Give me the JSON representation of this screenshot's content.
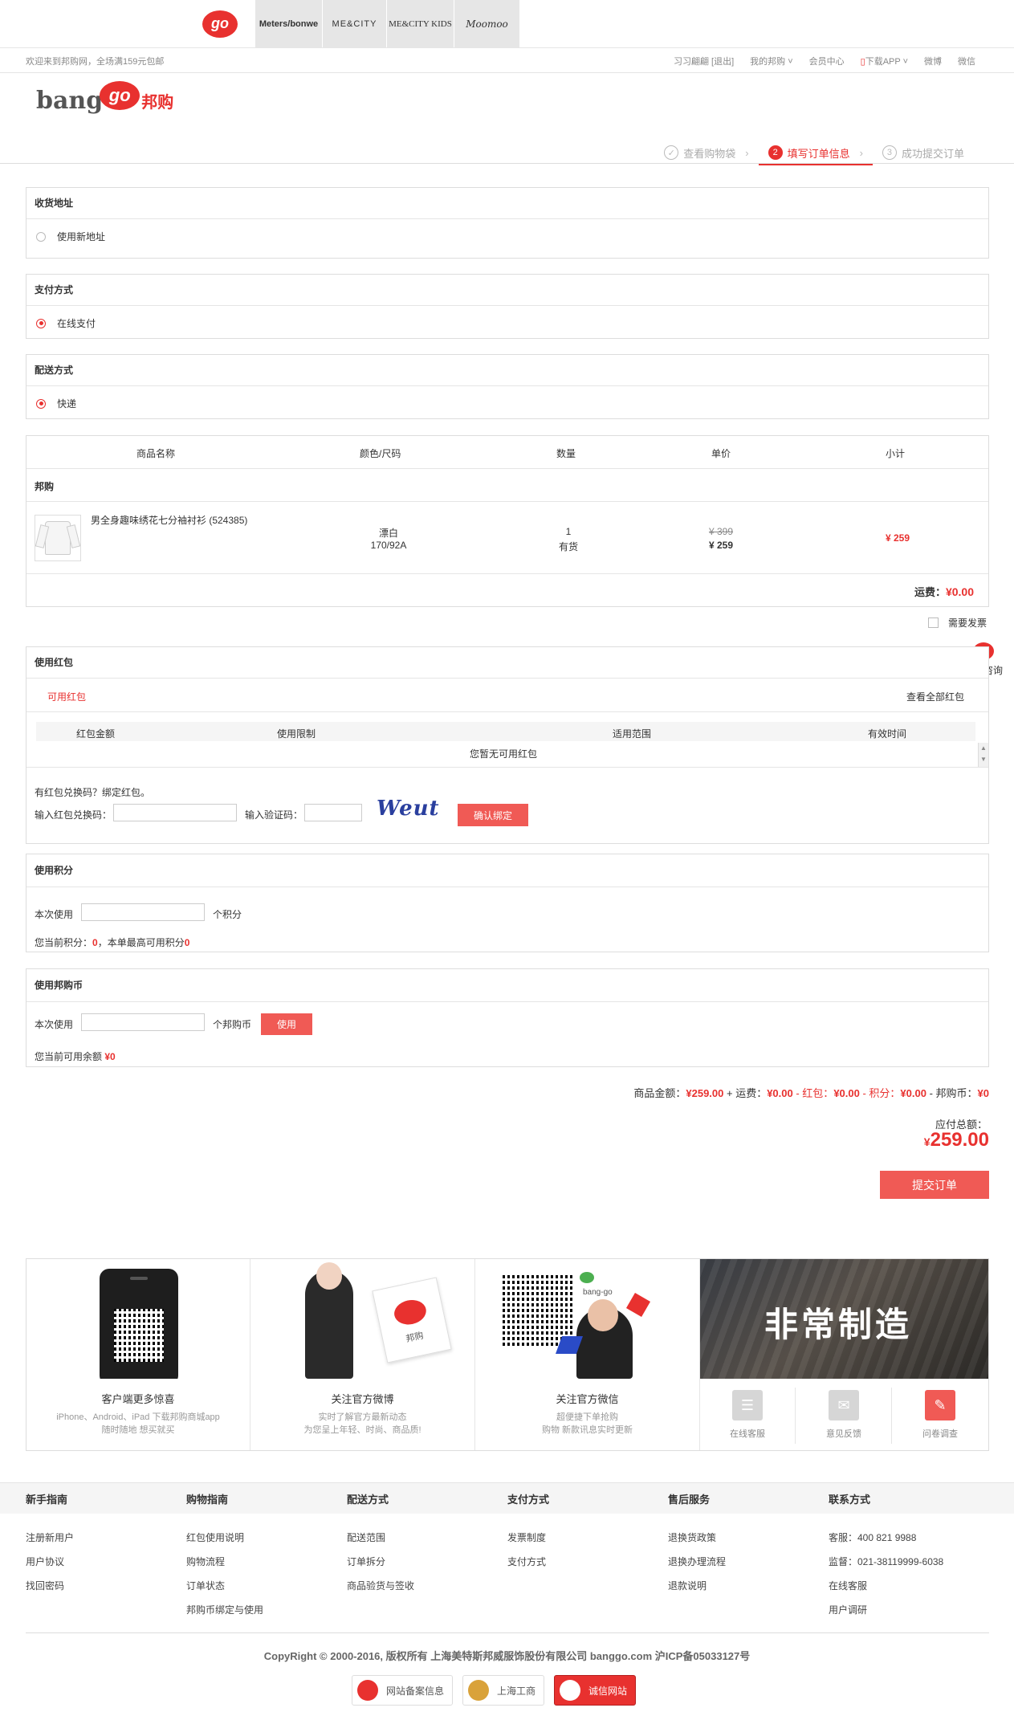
{
  "brands": [
    "go",
    "Meters/bonwe",
    "ME&CITY",
    "ME&CITY KIDS",
    "Moomoo"
  ],
  "topbar": {
    "welcome": "欢迎来到邦购网，全场满159元包邮",
    "user": "习习翩翩 [退出]",
    "links": [
      "我的邦购 ˅",
      "会员中心",
      "下载APP ˅",
      "微博",
      "微信"
    ]
  },
  "logo": {
    "bang": "bang",
    "go": "go",
    "cn": "邦购"
  },
  "steps": [
    {
      "num": "✓",
      "label": "查看购物袋"
    },
    {
      "num": "2",
      "label": "填写订单信息"
    },
    {
      "num": "3",
      "label": "成功提交订单"
    }
  ],
  "address": {
    "title": "收货地址",
    "option": "使用新地址"
  },
  "payment": {
    "title": "支付方式",
    "option": "在线支付"
  },
  "delivery": {
    "title": "配送方式",
    "option": "快递"
  },
  "order": {
    "headers": [
      "商品名称",
      "颜色/尺码",
      "数量",
      "单价",
      "小计"
    ],
    "store": "邦购",
    "item": {
      "name": "男全身趣味绣花七分袖衬衫 (524385)",
      "color": "漂白",
      "size": "170/92A",
      "qty": "1",
      "stock": "有货",
      "orig_price": "¥ 399",
      "price": "¥ 259",
      "subtotal": "¥ 259"
    },
    "shipping_label": "运费：",
    "shipping_value": "¥0.00",
    "invoice": "需要发票"
  },
  "redpacket": {
    "title": "使用红包",
    "tab": "可用红包",
    "view_all": "查看全部红包",
    "cols": [
      "红包金额",
      "使用限制",
      "适用范围",
      "有效时间"
    ],
    "empty": "您暂无可用红包",
    "hint": "有红包兑换码？绑定红包。",
    "code_label": "输入红包兑换码：",
    "captcha_label": "输入验证码：",
    "captcha_text": "Weut",
    "bind_button": "确认绑定"
  },
  "points": {
    "title": "使用积分",
    "use_label": "本次使用",
    "unit": "个积分",
    "current_label": "您当前积分：",
    "current_value": "0",
    "max_label": "，本单最高可用积分",
    "max_value": "0"
  },
  "coins": {
    "title": "使用邦购币",
    "use_label": "本次使用",
    "unit": "个邦购币",
    "button": "使用",
    "balance_label": "您当前可用余额",
    "balance_value": "¥0"
  },
  "summary": {
    "goods_label": "商品金额：",
    "goods_value": "¥259.00",
    "ship_label": " + 运费：",
    "ship_value": "¥0.00",
    "red_label": " - 红包：",
    "red_value": "¥0.00",
    "points_label": " - 积分：",
    "points_value": "¥0.00",
    "coins_label": " - 邦购币：",
    "coins_value": "¥0",
    "total_label": "应付总额：",
    "total_currency": "¥",
    "total_value": "259.00",
    "submit": "提交订单"
  },
  "float": {
    "label": "在线咨询",
    "dots": "•••"
  },
  "promo": [
    {
      "title": "客户端更多惊喜",
      "sub1": "iPhone、Android、iPad 下载邦购商城app",
      "sub2": "随时随地 想买就买"
    },
    {
      "title": "关注官方微博",
      "sub1": "实时了解官方最新动态",
      "sub2": "为您呈上年轻、时尚、商品质!",
      "badge": "邦购"
    },
    {
      "title": "关注官方微信",
      "sub1": "超便捷下单抢购",
      "sub2": "购物 新款讯息实时更新",
      "wx": "bang-go"
    },
    {
      "banner": "非常制造",
      "services": [
        "在线客服",
        "意见反馈",
        "问卷调查"
      ]
    }
  ],
  "footer": {
    "cols": [
      {
        "title": "新手指南",
        "items": [
          "注册新用户",
          "用户协议",
          "找回密码"
        ]
      },
      {
        "title": "购物指南",
        "items": [
          "红包使用说明",
          "购物流程",
          "订单状态",
          "邦购币绑定与使用"
        ]
      },
      {
        "title": "配送方式",
        "items": [
          "配送范围",
          "订单拆分",
          "商品验货与签收"
        ]
      },
      {
        "title": "支付方式",
        "items": [
          "发票制度",
          "支付方式"
        ]
      },
      {
        "title": "售后服务",
        "items": [
          "退换货政策",
          "退换办理流程",
          "退款说明"
        ]
      },
      {
        "title": "联系方式",
        "items": [
          "客服：400 821 9988",
          "监督：021-38119999-6038",
          "在线客服",
          "用户调研"
        ]
      }
    ],
    "copyright": "CopyRight © 2000-2016, 版权所有 上海美特斯邦威服饰股份有限公司 banggo.com 沪ICP备05033127号",
    "badges": [
      "网站备案信息",
      "上海工商",
      "诚信网站"
    ]
  },
  "colors": {
    "accent": "#e8312f",
    "button": "#f05a55",
    "border": "#dddddd"
  }
}
